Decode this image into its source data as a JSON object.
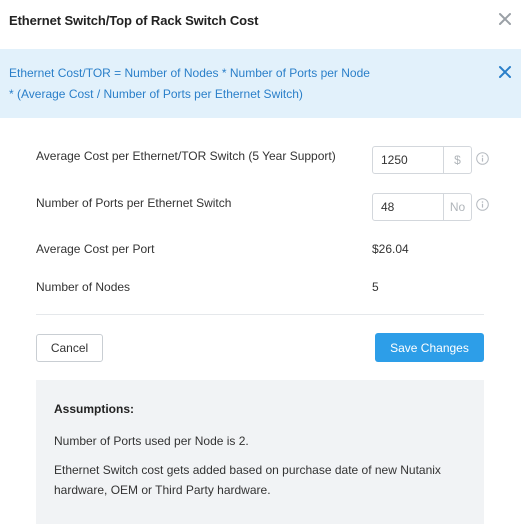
{
  "dialog": {
    "title": "Ethernet Switch/Top of Rack Switch Cost"
  },
  "banner": {
    "line1": "Ethernet Cost/TOR = Number of Nodes * Number of Ports per Node",
    "line2": "* (Average Cost / Number of Ports per Ethernet Switch)"
  },
  "fields": {
    "avg_cost_label": "Average Cost per Ethernet/TOR Switch (5 Year Support)",
    "avg_cost_value": "1250",
    "avg_cost_unit": "$",
    "ports_label": "Number of Ports per Ethernet Switch",
    "ports_value": "48",
    "ports_unit": "No",
    "cost_per_port_label": "Average Cost per Port",
    "cost_per_port_value": "$26.04",
    "nodes_label": "Number of Nodes",
    "nodes_value": "5"
  },
  "buttons": {
    "cancel": "Cancel",
    "save": "Save Changes"
  },
  "assumptions": {
    "title": "Assumptions:",
    "p1": "Number of Ports used per Node is 2.",
    "p2": "Ethernet Switch cost gets added based on purchase date of new Nutanix hardware, OEM or Third Party hardware."
  },
  "colors": {
    "accent": "#2d9ee8",
    "banner_bg": "#e2f1fb",
    "banner_text": "#2a7fc9",
    "assumptions_bg": "#f1f3f5"
  },
  "icons": [
    "close-icon",
    "banner-close-icon",
    "info-icon"
  ]
}
